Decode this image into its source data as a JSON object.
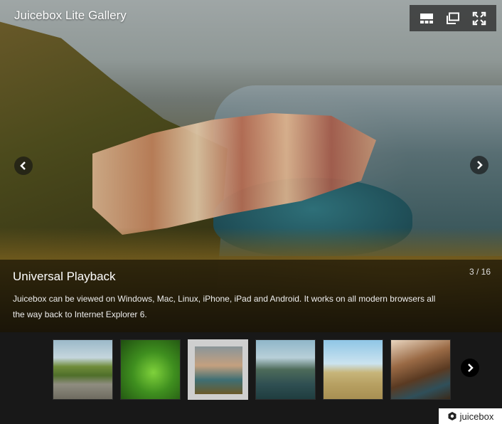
{
  "gallery": {
    "title": "Juicebox Lite Gallery"
  },
  "toolbar": {
    "items": [
      {
        "name": "thumbnails",
        "icon": "grid-icon"
      },
      {
        "name": "open-in-new-window",
        "icon": "new-window-icon"
      },
      {
        "name": "fullscreen",
        "icon": "expand-icon"
      }
    ]
  },
  "caption": {
    "title": "Universal Playback",
    "counter": "3 / 16",
    "description": "Juicebox can be viewed on Windows, Mac, Linux, iPhone, iPad and Android. It works on all modern browsers all the way back to Internet Explorer 6."
  },
  "thumbnails": [
    {
      "id": "road",
      "active": false
    },
    {
      "id": "leaves",
      "active": false
    },
    {
      "id": "village",
      "active": true
    },
    {
      "id": "river",
      "active": false
    },
    {
      "id": "beach-path",
      "active": false
    },
    {
      "id": "cliffs",
      "active": false
    }
  ],
  "branding": {
    "label": "juicebox"
  },
  "colors": {
    "caption_bg": "#000000",
    "strip_bg": "#181818"
  }
}
